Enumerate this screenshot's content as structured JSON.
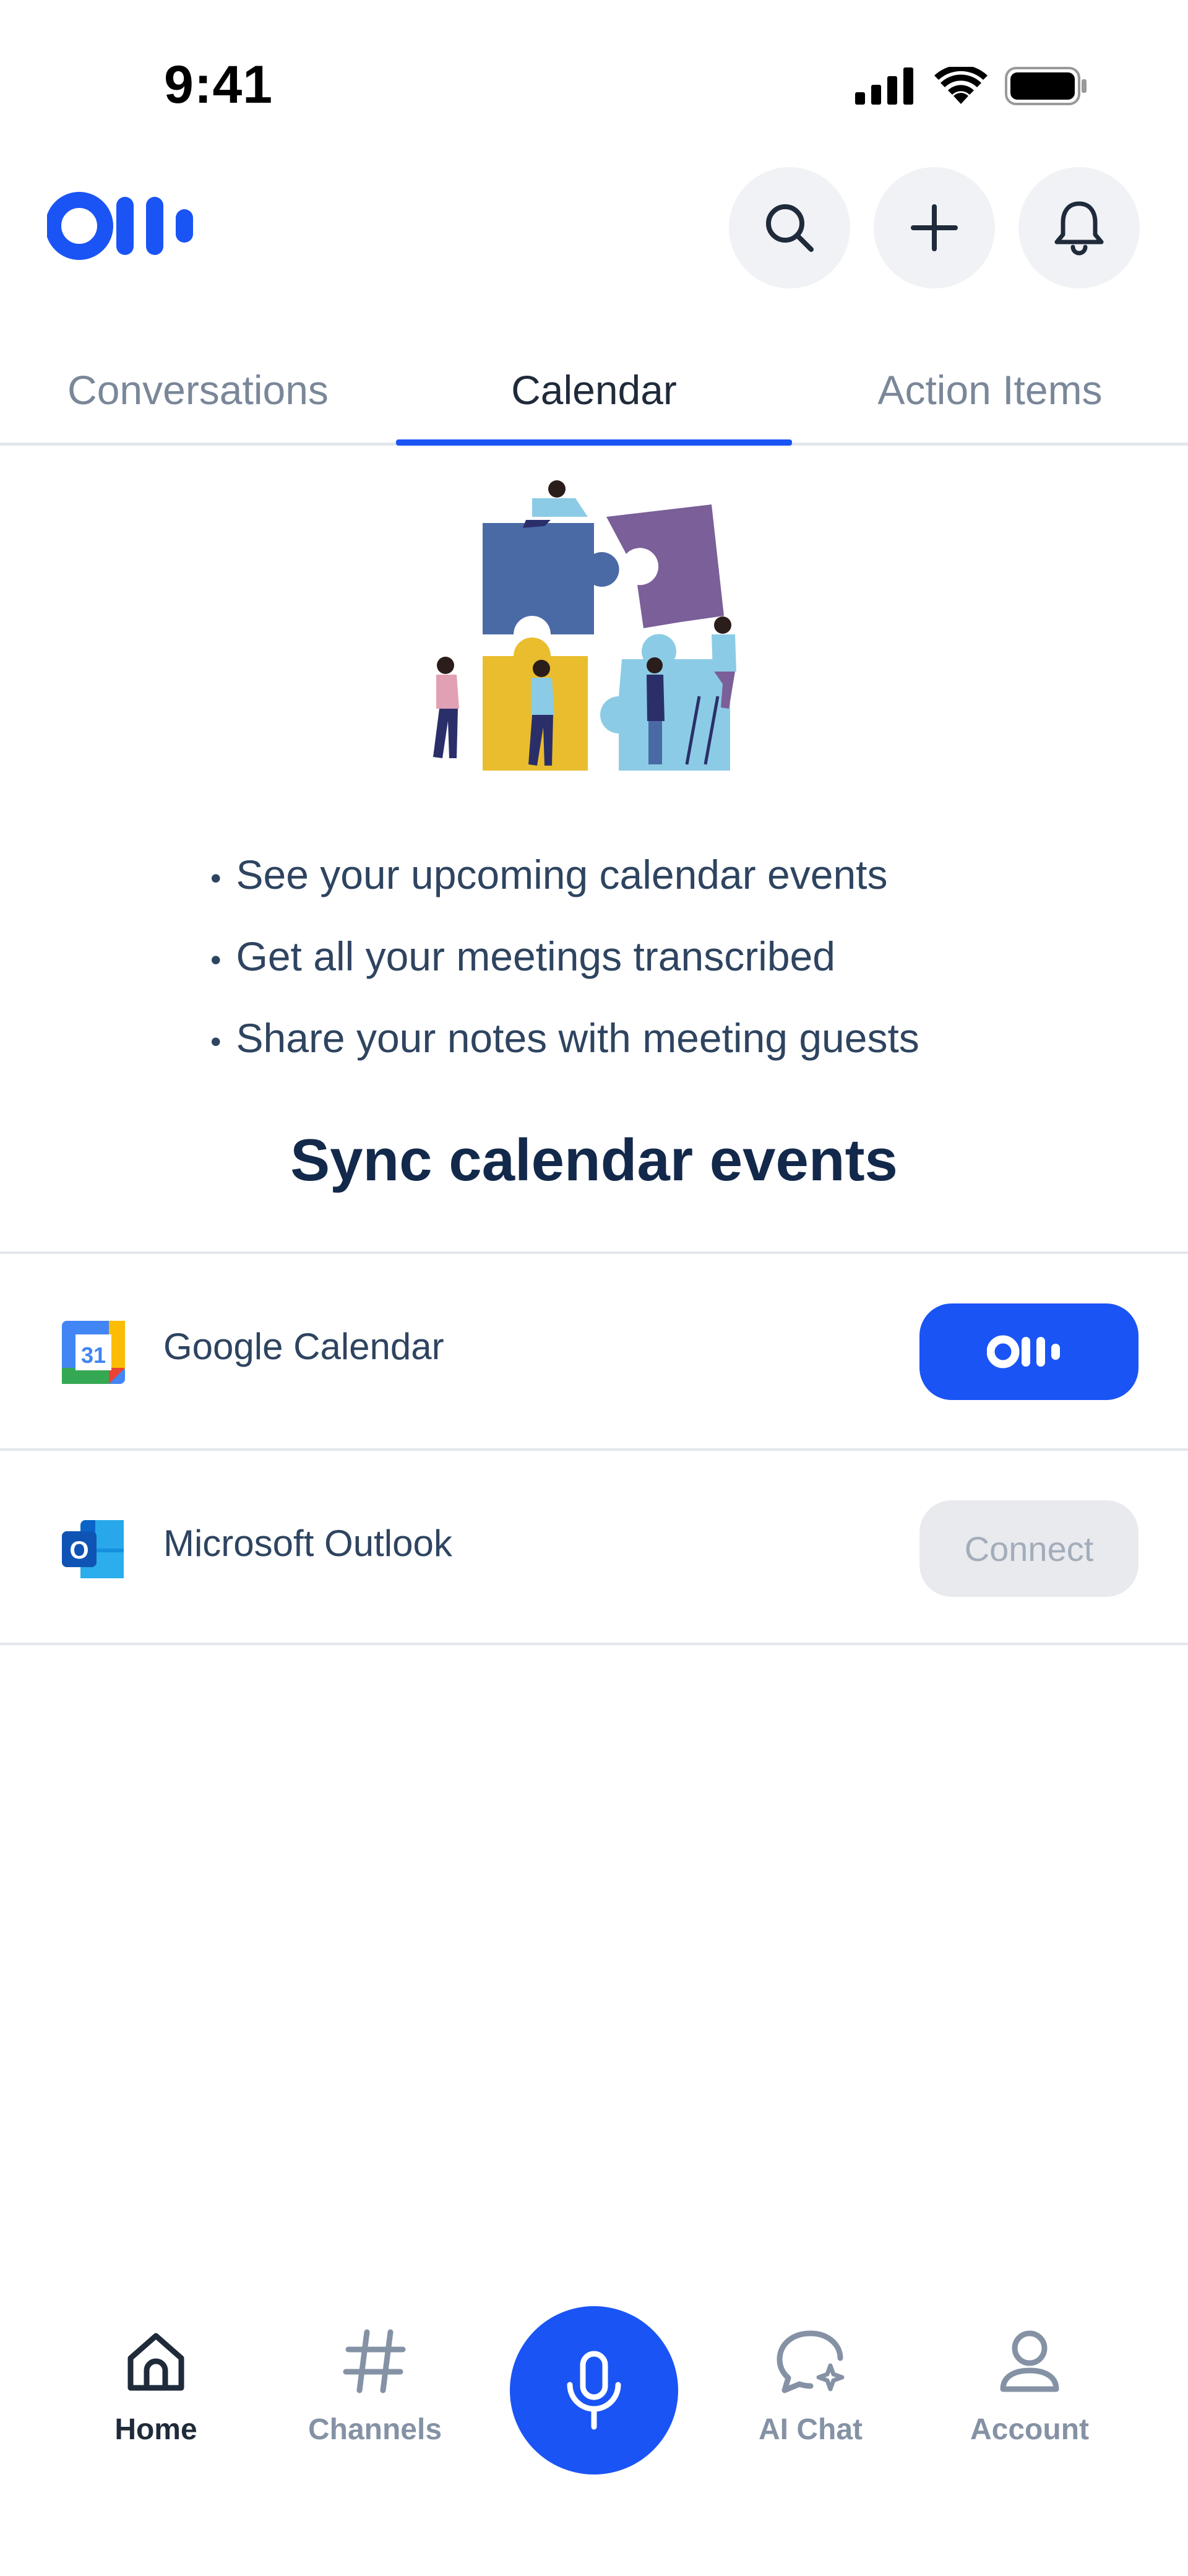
{
  "status_bar": {
    "time": "9:41"
  },
  "header": {
    "logo_icon": "otter-logo-icon",
    "buttons": [
      "search-icon",
      "plus-icon",
      "bell-icon"
    ]
  },
  "tabs": [
    {
      "label": "Conversations",
      "active": false
    },
    {
      "label": "Calendar",
      "active": true
    },
    {
      "label": "Action Items",
      "active": false
    }
  ],
  "hero": {
    "bullets": [
      "See your upcoming calendar events",
      "Get all your meetings transcribed",
      "Share your notes with meeting guests"
    ],
    "sync_title": "Sync calendar events"
  },
  "calendars": [
    {
      "label": "Google Calendar",
      "icon": "google-calendar-icon",
      "action": "connected"
    },
    {
      "label": "Microsoft Outlook",
      "icon": "outlook-icon",
      "action_label": "Connect"
    }
  ],
  "bottom_nav": {
    "items": [
      {
        "label": "Home",
        "icon": "home-icon",
        "active": true
      },
      {
        "label": "Channels",
        "icon": "hash-icon",
        "active": false
      },
      {
        "label": "AI Chat",
        "icon": "chat-sparkle-icon",
        "active": false
      },
      {
        "label": "Account",
        "icon": "user-icon",
        "active": false
      }
    ],
    "record_icon": "mic-icon"
  },
  "colors": {
    "accent": "#1a54f5",
    "text_dark": "#13294b",
    "text_muted": "#7a8799"
  }
}
